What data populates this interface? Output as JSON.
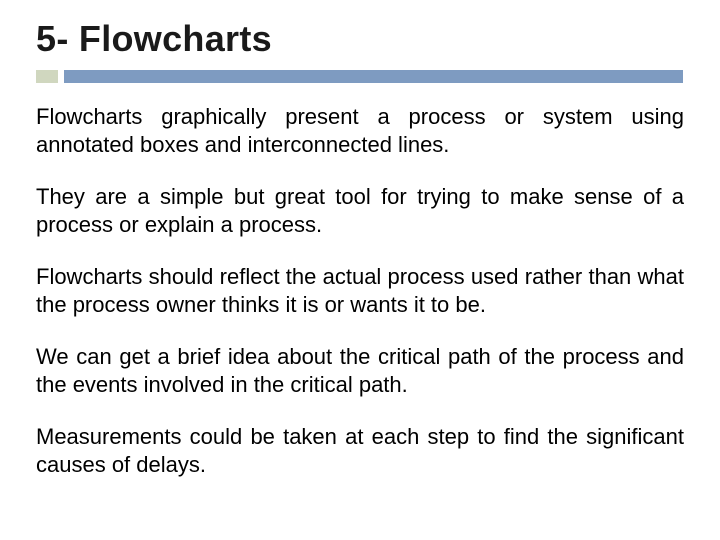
{
  "slide": {
    "title": "5- Flowcharts",
    "paragraphs": [
      "Flowcharts graphically present a process or system using annotated boxes and interconnected lines.",
      "They are a simple but great tool for trying to make sense of a process or explain a process.",
      "Flowcharts should reflect the actual process used rather than what the process owner thinks it is or wants it to be.",
      "We can get a brief idea about the critical path of the process and the events involved in the critical path.",
      "Measurements could be taken at each step to find the significant causes of delays."
    ]
  }
}
